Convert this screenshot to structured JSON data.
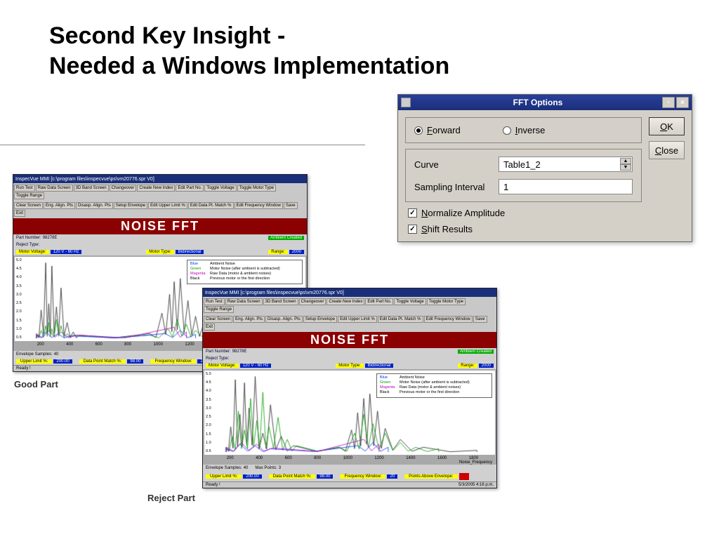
{
  "title_line1": "Second Key Insight -",
  "title_line2": "Needed a Windows Implementation",
  "dialog": {
    "title": "FFT Options",
    "forward": "Forward",
    "inverse": "Inverse",
    "curve_label": "Curve",
    "curve_value": "Table1_2",
    "sampling_label": "Sampling Interval",
    "sampling_value": "1",
    "normalize": "Normalize Amplitude",
    "shift": "Shift Results",
    "ok": "OK",
    "close": "Close"
  },
  "fft": {
    "win_title": "InspecVue MMI [c:\\program files\\inspecvue\\ps\\vm20776.spr V0]",
    "toolbar": [
      "Run Test",
      "Raw Data Screen",
      "3D Band Screen",
      "Changeover",
      "Create New Index",
      "Edit Part No.",
      "Toggle Voltage",
      "Toggle Motor Type",
      "Toggle Range"
    ],
    "toolbar2": [
      "Clear Screen",
      "Eng. Align. Pts",
      "Disasp. Align. Pts",
      "Setup Envelope",
      "Edit Upper Limit %",
      "Edit Data Pt. Match %",
      "Edit Frequency Window",
      "Save",
      "Exit"
    ],
    "banner": "NOISE FFT",
    "part_no_label": "Part Number:",
    "part_no": "98278E",
    "reject_label": "Reject Type:",
    "mv_label": "Motor Voltage:",
    "mv_val": "120 V - 60 Hz",
    "mt_label": "Motor Type:",
    "mt_val": "Bidirectional",
    "range_label": "Range:",
    "range_val": "2000",
    "legend": [
      {
        "color": "#0030ff",
        "name": "Blue",
        "desc": "Ambient Noise"
      },
      {
        "color": "#00a000",
        "name": "Green",
        "desc": "Motor Noise (after ambient is subtracted)"
      },
      {
        "color": "#c000c0",
        "name": "Magenta",
        "desc": "Raw Data (motor & ambient noises)"
      },
      {
        "color": "#000",
        "name": "Black",
        "desc": "Previous motor or the first direction"
      }
    ],
    "xticks": [
      "200",
      "400",
      "600",
      "800",
      "1000",
      "1200",
      "1400",
      "1600",
      "1800"
    ],
    "yticks": [
      "5.0",
      "4.5",
      "4.0",
      "3.5",
      "3.0",
      "2.5",
      "2.0",
      "1.5",
      "1.0",
      "0.5"
    ],
    "xlabel": "Noise_Frequency",
    "env_label": "Envelope Samples:",
    "env_val": "40",
    "maxpts_label": "Max Points:",
    "maxpts_val": "3",
    "upper_label": "Upper Limit %:",
    "upper_val": "200.00",
    "match_label": "Data Point Match %:",
    "match_val": "98.00",
    "fw_label": "Frequency Window:",
    "fw_val": "20",
    "points_above": "Points Above Envelope:",
    "status_ready": "Ready !",
    "status_time": "5/3/2005   4:16 p.m.",
    "ambient": "Ambient Created"
  },
  "captions": {
    "good": "Good Part",
    "reject": "Reject Part"
  },
  "chart_data": [
    {
      "type": "line",
      "label": "Good Part FFT",
      "xlim": [
        0,
        1800
      ],
      "ylim": [
        0,
        5
      ],
      "xlabel": "Noise_Frequency",
      "ylabel": "",
      "series": [
        {
          "name": "Black",
          "color": "#222",
          "x": [
            60,
            90,
            120,
            140,
            160,
            190,
            220,
            260,
            300,
            340,
            800,
            880,
            930,
            960,
            1000,
            1050,
            1100,
            1150,
            1250,
            1400,
            1700
          ],
          "y": [
            0.3,
            1.8,
            4.8,
            2.2,
            4.6,
            2.0,
            3.2,
            1.0,
            0.4,
            0.2,
            0.3,
            1.6,
            2.8,
            3.6,
            3.8,
            2.4,
            1.4,
            0.8,
            0.4,
            0.2,
            0.1
          ]
        },
        {
          "name": "Green",
          "color": "#00a000",
          "x": [
            60,
            90,
            120,
            140,
            160,
            190,
            220,
            260,
            300,
            800,
            920,
            980,
            1040,
            1100,
            1200,
            1400
          ],
          "y": [
            0.2,
            0.5,
            0.8,
            1.0,
            0.6,
            1.2,
            0.8,
            0.3,
            0.2,
            0.2,
            0.6,
            1.2,
            0.9,
            0.5,
            0.3,
            0.1
          ]
        },
        {
          "name": "Blue",
          "color": "#0030ff",
          "x": [
            60,
            120,
            200,
            280,
            900,
            1000,
            1100
          ],
          "y": [
            0.2,
            0.4,
            0.3,
            0.15,
            0.3,
            0.5,
            0.25
          ]
        },
        {
          "name": "Magenta",
          "color": "#c000c0",
          "x": [
            60,
            140,
            220,
            320,
            960,
            1040
          ],
          "y": [
            0.25,
            0.5,
            0.4,
            0.2,
            0.7,
            0.4
          ]
        }
      ]
    },
    {
      "type": "line",
      "label": "Reject Part FFT",
      "xlim": [
        0,
        1800
      ],
      "ylim": [
        0,
        5
      ],
      "xlabel": "Noise_Frequency",
      "ylabel": "",
      "series": [
        {
          "name": "Black",
          "color": "#222",
          "x": [
            60,
            90,
            120,
            150,
            180,
            210,
            250,
            300,
            350,
            420,
            500,
            800,
            880,
            920,
            960,
            1000,
            1050,
            1100,
            1200,
            1350,
            1700
          ],
          "y": [
            0.3,
            1.6,
            4.6,
            2.4,
            4.4,
            2.8,
            4.8,
            1.2,
            3.0,
            1.0,
            0.4,
            0.3,
            1.4,
            2.5,
            3.4,
            3.7,
            2.6,
            1.5,
            0.8,
            0.3,
            0.1
          ]
        },
        {
          "name": "Green",
          "color": "#00a000",
          "x": [
            60,
            100,
            140,
            180,
            220,
            260,
            300,
            340,
            400,
            460,
            520,
            800,
            900,
            960,
            1020,
            1100,
            1200,
            1300,
            1450
          ],
          "y": [
            0.3,
            1.0,
            2.6,
            1.4,
            3.4,
            2.0,
            3.8,
            1.6,
            2.2,
            0.8,
            0.4,
            0.3,
            1.2,
            2.4,
            1.8,
            1.2,
            0.6,
            0.3,
            0.2
          ]
        },
        {
          "name": "Blue",
          "color": "#0030ff",
          "x": [
            60,
            150,
            250,
            350,
            920,
            1020,
            1120
          ],
          "y": [
            0.2,
            0.5,
            0.4,
            0.2,
            0.4,
            0.6,
            0.3
          ]
        },
        {
          "name": "Magenta",
          "color": "#c000c0",
          "x": [
            60,
            160,
            260,
            360,
            960,
            1060
          ],
          "y": [
            0.3,
            0.6,
            0.5,
            0.25,
            0.8,
            0.5
          ]
        }
      ]
    }
  ]
}
